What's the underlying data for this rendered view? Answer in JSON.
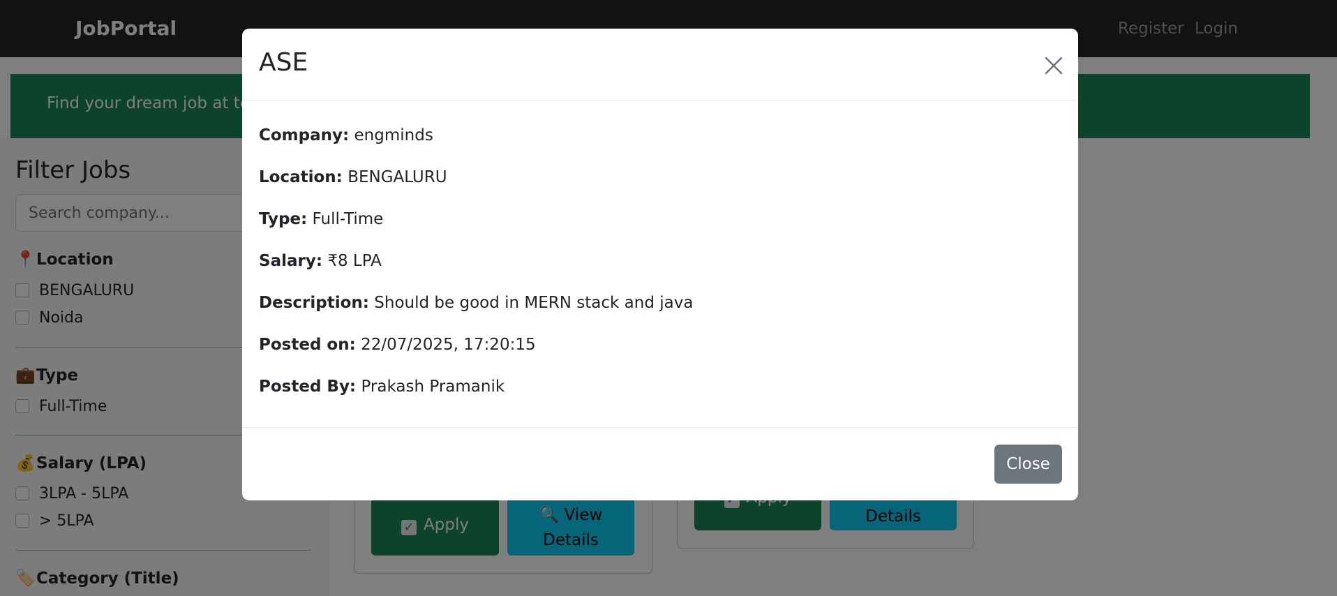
{
  "navbar": {
    "brand": "JobPortal",
    "links": [
      "Register",
      "Login"
    ]
  },
  "hero": {
    "text": "Find your dream job at top companies"
  },
  "sidebar": {
    "title": "Filter Jobs",
    "search_placeholder": "Search company...",
    "sections": [
      {
        "icon": "pin-icon",
        "glyph": "📍",
        "label": "Location",
        "options": [
          "BENGALURU",
          "Noida"
        ]
      },
      {
        "icon": "briefcase-icon",
        "glyph": "💼",
        "label": "Type",
        "options": [
          "Full-Time"
        ]
      },
      {
        "icon": "money-bag-icon",
        "glyph": "💰",
        "label": "Salary (LPA)",
        "options": [
          "3LPA - 5LPA",
          "> 5LPA"
        ]
      },
      {
        "icon": "tag-icon",
        "glyph": "🏷️",
        "label": "Category (Title)",
        "options": []
      }
    ]
  },
  "cards": [
    {
      "apply_label": "Apply",
      "view_label_1": "🔍 View",
      "view_label_2": "Details"
    },
    {
      "apply_label": "Apply",
      "view_label_1": "",
      "view_label_2": "Details"
    }
  ],
  "modal": {
    "title": "ASE",
    "fields": [
      {
        "label": "Company:",
        "value": "engminds"
      },
      {
        "label": "Location:",
        "value": "BENGALURU"
      },
      {
        "label": "Type:",
        "value": "Full-Time"
      },
      {
        "label": "Salary:",
        "value": "₹8 LPA"
      },
      {
        "label": "Description:",
        "value": "Should be good in MERN stack and java"
      },
      {
        "label": "Posted on:",
        "value": "22/07/2025, 17:20:15"
      },
      {
        "label": "Posted By:",
        "value": "Prakash Pramanik"
      }
    ],
    "close_label": "Close"
  },
  "colors": {
    "navbar": "#212529",
    "hero": "#198754",
    "apply_button": "#198754",
    "view_button": "#0dcaf0",
    "close_button": "#6c757d"
  }
}
